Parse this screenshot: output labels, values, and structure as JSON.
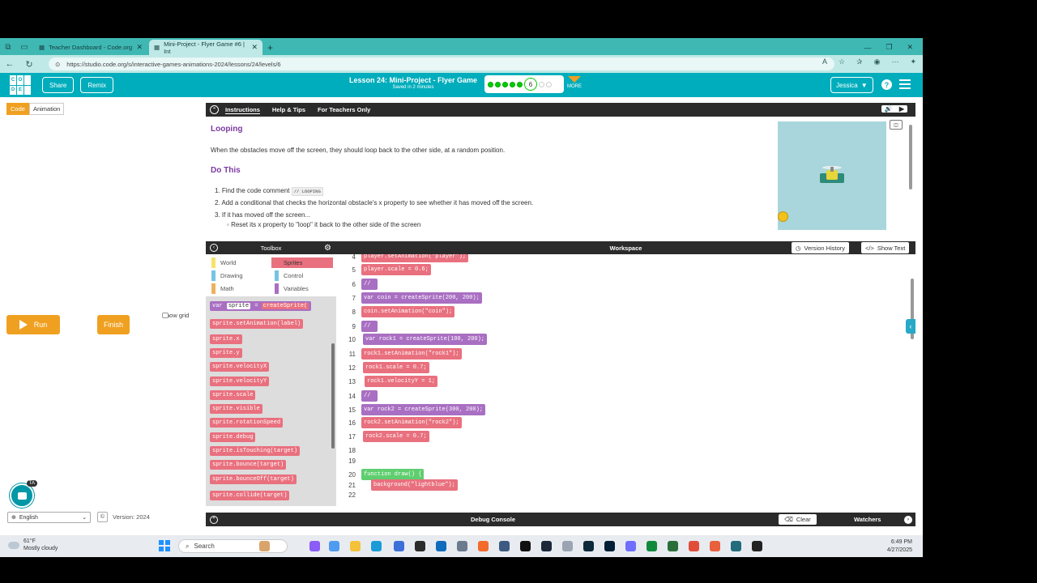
{
  "browser": {
    "tabs": [
      {
        "label": "Teacher Dashboard - Code.org",
        "active": false
      },
      {
        "label": "Mini-Project - Flyer Game #6 | Int",
        "active": true
      }
    ],
    "url": "https://studio.code.org/s/interactive-games-animations-2024/lessons/24/levels/6"
  },
  "header": {
    "logo_letters": [
      "C",
      "O",
      "D",
      "E"
    ],
    "share_label": "Share",
    "remix_label": "Remix",
    "lesson_title": "Lesson 24: Mini-Project - Flyer Game",
    "saved_text": "Saved in 2 minutes",
    "current_level": "6",
    "levels_completed": 5,
    "levels_remaining": 2,
    "more_label": "MORE",
    "user_name": "Jessica",
    "help_label": "?"
  },
  "left_panel": {
    "mode_tabs": [
      "Code",
      "Animation"
    ],
    "run_label": "Run",
    "finish_label": "Finish",
    "show_grid_label": "Show grid",
    "ta_badge": "TA",
    "language": "English",
    "version_label": "Version: 2024"
  },
  "instructions": {
    "tabs": [
      "Instructions",
      "Help & Tips",
      "For Teachers Only"
    ],
    "heading1": "Looping",
    "intro": "When the obstacles move off the screen, they should loop back to the other side, at a random position.",
    "heading2": "Do This",
    "step1": "1. Find the code comment",
    "step1_code": "// LOOPING",
    "step2": "2. Add a conditional that checks the horizontal obstacle's x property to see whether it has moved off the screen.",
    "step3": "3. If it has moved off the screen...",
    "step3a": "Reset its x property to \"loop\" it back to the other side of the screen"
  },
  "toolbox": {
    "title": "Toolbox",
    "categories": [
      {
        "label": "World",
        "color": "#f7e26b"
      },
      {
        "label": "Sprites",
        "color": "#e9707e",
        "selected": true
      },
      {
        "label": "Drawing",
        "color": "#74c4e4"
      },
      {
        "label": "Control",
        "color": "#74c4e4"
      },
      {
        "label": "Math",
        "color": "#f0b060"
      },
      {
        "label": "Variables",
        "color": "#a96fc2"
      }
    ],
    "blocks": [
      "sprite.setAnimation(label)",
      "sprite.x",
      "sprite.y",
      "sprite.velocityX",
      "sprite.velocityY",
      "sprite.scale",
      "sprite.visible",
      "sprite.rotationSpeed",
      "sprite.debug",
      "sprite.isTouching(target)",
      "sprite.bounce(target)",
      "sprite.bounceOff(target)",
      "sprite.collide(target)"
    ],
    "create_block": {
      "kw": "var",
      "name": "sprite",
      "op": "=",
      "fn": "createSprite("
    }
  },
  "workspace": {
    "title": "Workspace",
    "version_history_label": "Version History",
    "show_text_label": "Show Text",
    "lines": [
      {
        "n": "4",
        "text": "player.setAnimation(\"player\");"
      },
      {
        "n": "5",
        "text": "player.scale = 0.6;"
      },
      {
        "n": "6",
        "text": "//"
      },
      {
        "n": "7",
        "text": "var coin = createSprite(200, 200);"
      },
      {
        "n": "8",
        "text": "coin.setAnimation(\"coin\");"
      },
      {
        "n": "9",
        "text": "//"
      },
      {
        "n": "10",
        "text": "var rock1 = createSprite(100, 200);"
      },
      {
        "n": "11",
        "text": "rock1.setAnimation(\"rock1\");"
      },
      {
        "n": "12",
        "text": "rock1.scale = 0.7;"
      },
      {
        "n": "13",
        "text": "rock1.velocityY = 1;"
      },
      {
        "n": "14",
        "text": "//"
      },
      {
        "n": "15",
        "text": "var rock2 = createSprite(300, 200);"
      },
      {
        "n": "16",
        "text": "rock2.setAnimation(\"rock2\");"
      },
      {
        "n": "17",
        "text": "rock2.scale = 0.7;"
      },
      {
        "n": "18",
        "text": ""
      },
      {
        "n": "19",
        "text": ""
      },
      {
        "n": "20",
        "text": "function draw() {"
      },
      {
        "n": "21",
        "text": "background(\"lightblue\");"
      },
      {
        "n": "22",
        "text": ""
      }
    ]
  },
  "debug": {
    "title": "Debug Console",
    "clear_label": "Clear",
    "watchers_label": "Watchers"
  },
  "taskbar": {
    "temp": "61°F",
    "weather": "Mostly cloudy",
    "search_placeholder": "Search",
    "time": "6:49 PM",
    "date": "4/27/2025"
  },
  "colors": {
    "teal_header": "#00adbc",
    "sprite_block": "#e9707e",
    "var_block": "#a96fc2",
    "fn_block": "#5fce6f",
    "run_orange": "#f0a020"
  }
}
